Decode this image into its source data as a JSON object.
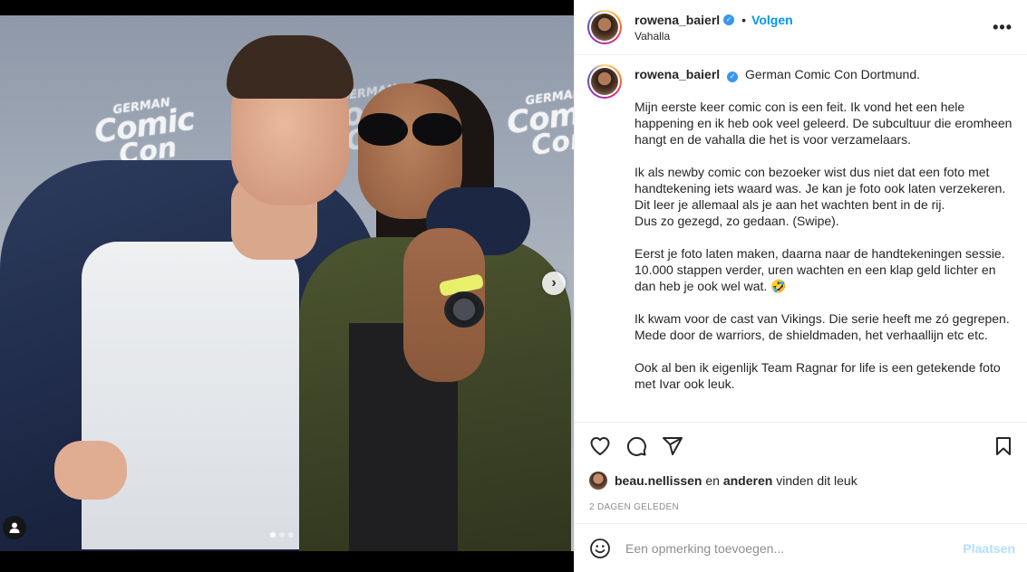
{
  "photo": {
    "backdrop_logo": {
      "line1": "GERMAN",
      "line2": "Comic",
      "line3": "Con"
    },
    "next_label": "›",
    "dots": [
      true,
      false,
      false
    ]
  },
  "header": {
    "username": "rowena_baierl",
    "verified_glyph": "✓",
    "separator": "•",
    "follow_label": "Volgen",
    "location": "Vahalla",
    "more_label": "•••"
  },
  "caption": {
    "username": "rowena_baierl",
    "verified_glyph": "✓",
    "headline": "German Comic Con Dortmund.",
    "paragraphs": [
      "Mijn eerste keer comic con is een feit. Ik vond het een hele happening en ik heb ook veel geleerd. De subcultuur die eromheen hangt en de vahalla die het is voor verzamelaars.",
      "Ik als newby comic con bezoeker wist dus niet dat een foto met handtekening iets waard was. Je kan je foto ook laten verzekeren.\nDit leer je allemaal als je aan het wachten bent in de rij.\nDus zo gezegd, zo gedaan. (Swipe).",
      "Eerst je foto laten maken, daarna naar de handtekeningen sessie. 10.000 stappen verder, uren wachten en een klap geld lichter en dan heb je ook wel wat. 🤣",
      "Ik kwam voor de cast van Vikings. Die serie heeft me zó gegrepen. Mede door de warriors, de shieldmaden, het verhaallijn etc etc.",
      "Ook al ben ik eigenlijk Team Ragnar for life is een getekende foto met Ivar ook leuk."
    ]
  },
  "actions": {
    "icons": [
      "heart-icon",
      "comment-icon",
      "share-icon",
      "bookmark-icon"
    ]
  },
  "likes": {
    "user": "beau.nellissen",
    "connector": "en",
    "others": "anderen",
    "suffix": "vinden dit leuk"
  },
  "timestamp": "2 DAGEN GELEDEN",
  "comment": {
    "placeholder": "Een opmerking toevoegen...",
    "post_label": "Plaatsen"
  },
  "colors": {
    "accent": "#0095f6",
    "post_disabled": "#b2dffc",
    "muted": "#8e8e8e",
    "text": "#262626"
  }
}
